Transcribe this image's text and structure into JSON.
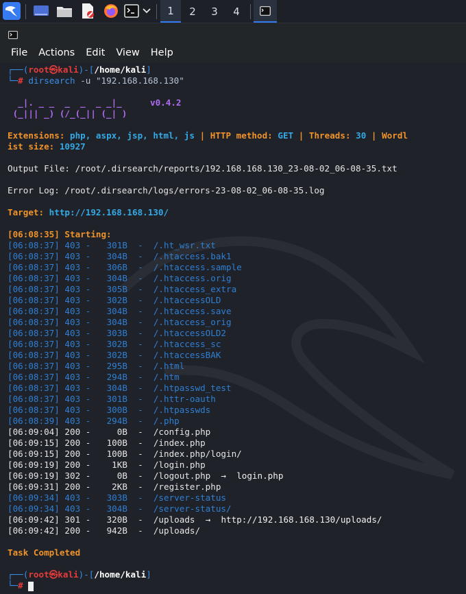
{
  "panel": {
    "workspaces": [
      "1",
      "2",
      "3",
      "4"
    ]
  },
  "menu": [
    "File",
    "Actions",
    "Edit",
    "View",
    "Help"
  ],
  "prompt": {
    "user": "root",
    "at": "㉿",
    "host": "kali",
    "path": "/home/kali",
    "symbol": "#",
    "command": "dirsearch",
    "args": "-u \"192.168.168.130\""
  },
  "logo": {
    "line1": "  _|. _ _  _  _  _ _|_",
    "line2": " (_||| _) (/_(_|| (_| )",
    "version": "v0.4.2"
  },
  "config": {
    "ext_label": "Extensions:",
    "ext_value": "php, aspx, jsp, html, js",
    "sep": "|",
    "method_label": "HTTP method:",
    "method_value": "GET",
    "threads_label": "Threads:",
    "threads_value": "30",
    "wordl_label": "Wordl",
    "size_label": "ist size:",
    "size_value": "10927"
  },
  "output_file": "Output File: /root/.dirsearch/reports/192.168.168.130_23-08-02_06-08-35.txt",
  "error_log": "Error Log: /root/.dirsearch/logs/errors-23-08-02_06-08-35.log",
  "target": {
    "label": "Target:",
    "url": "http://192.168.168.130/"
  },
  "starting": "[06:08:35] Starting:",
  "results": [
    {
      "time": "[06:08:37]",
      "code": "403",
      "size": " 301B",
      "path": "/.ht_wsr.txt",
      "kind": "blue"
    },
    {
      "time": "[06:08:37]",
      "code": "403",
      "size": " 304B",
      "path": "/.htaccess.bak1",
      "kind": "blue"
    },
    {
      "time": "[06:08:37]",
      "code": "403",
      "size": " 306B",
      "path": "/.htaccess.sample",
      "kind": "blue"
    },
    {
      "time": "[06:08:37]",
      "code": "403",
      "size": " 304B",
      "path": "/.htaccess.orig",
      "kind": "blue"
    },
    {
      "time": "[06:08:37]",
      "code": "403",
      "size": " 305B",
      "path": "/.htaccess_extra",
      "kind": "blue"
    },
    {
      "time": "[06:08:37]",
      "code": "403",
      "size": " 302B",
      "path": "/.htaccessOLD",
      "kind": "blue"
    },
    {
      "time": "[06:08:37]",
      "code": "403",
      "size": " 304B",
      "path": "/.htaccess.save",
      "kind": "blue"
    },
    {
      "time": "[06:08:37]",
      "code": "403",
      "size": " 304B",
      "path": "/.htaccess_orig",
      "kind": "blue"
    },
    {
      "time": "[06:08:37]",
      "code": "403",
      "size": " 303B",
      "path": "/.htaccessOLD2",
      "kind": "blue"
    },
    {
      "time": "[06:08:37]",
      "code": "403",
      "size": " 302B",
      "path": "/.htaccess_sc",
      "kind": "blue"
    },
    {
      "time": "[06:08:37]",
      "code": "403",
      "size": " 302B",
      "path": "/.htaccessBAK",
      "kind": "blue"
    },
    {
      "time": "[06:08:37]",
      "code": "403",
      "size": " 295B",
      "path": "/.html",
      "kind": "blue"
    },
    {
      "time": "[06:08:37]",
      "code": "403",
      "size": " 294B",
      "path": "/.htm",
      "kind": "blue"
    },
    {
      "time": "[06:08:37]",
      "code": "403",
      "size": " 304B",
      "path": "/.htpasswd_test",
      "kind": "blue"
    },
    {
      "time": "[06:08:37]",
      "code": "403",
      "size": " 301B",
      "path": "/.httr-oauth",
      "kind": "blue"
    },
    {
      "time": "[06:08:37]",
      "code": "403",
      "size": " 300B",
      "path": "/.htpasswds",
      "kind": "blue"
    },
    {
      "time": "[06:08:39]",
      "code": "403",
      "size": " 294B",
      "path": "/.php",
      "kind": "blue"
    },
    {
      "time": "[06:09:04]",
      "code": "200",
      "size": "   0B",
      "path": "/config.php",
      "kind": "white"
    },
    {
      "time": "[06:09:15]",
      "code": "200",
      "size": " 100B",
      "path": "/index.php",
      "kind": "white"
    },
    {
      "time": "[06:09:15]",
      "code": "200",
      "size": " 100B",
      "path": "/index.php/login/",
      "kind": "white"
    },
    {
      "time": "[06:09:19]",
      "code": "200",
      "size": "   1KB",
      "path": "/login.php",
      "kind": "white"
    },
    {
      "time": "[06:09:19]",
      "code": "302",
      "size": "   0B",
      "path": "/logout.php",
      "kind": "white",
      "redirect": "login.php"
    },
    {
      "time": "[06:09:31]",
      "code": "200",
      "size": "   2KB",
      "path": "/register.php",
      "kind": "white"
    },
    {
      "time": "[06:09:34]",
      "code": "403",
      "size": " 303B",
      "path": "/server-status",
      "kind": "blue"
    },
    {
      "time": "[06:09:34]",
      "code": "403",
      "size": " 304B",
      "path": "/server-status/",
      "kind": "blue"
    },
    {
      "time": "[06:09:42]",
      "code": "301",
      "size": " 320B",
      "path": "/uploads",
      "kind": "white",
      "redirect": "http://192.168.168.130/uploads/"
    },
    {
      "time": "[06:09:42]",
      "code": "200",
      "size": " 942B",
      "path": "/uploads/",
      "kind": "white"
    }
  ],
  "arrow": "→",
  "task_completed": "Task Completed",
  "colors": {
    "accent": "#367bf0",
    "orange": "#f0932b",
    "blue": "#3a8ee6",
    "red": "#e83b3b",
    "purple": "#b06bf0"
  },
  "icons": [
    "kali-menu-icon",
    "desktop-icon",
    "file-manager-icon",
    "text-editor-icon",
    "firefox-icon",
    "terminal-icon",
    "chevron-down-icon",
    "terminal-window-icon"
  ]
}
